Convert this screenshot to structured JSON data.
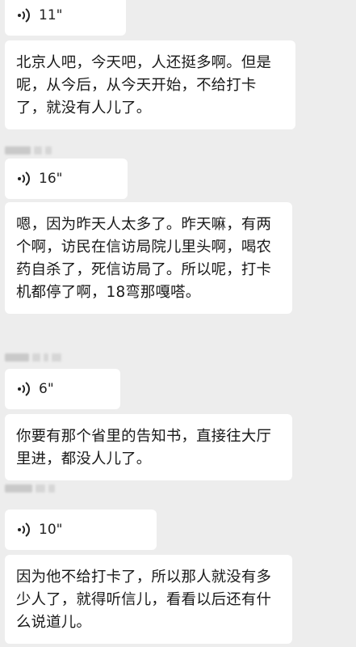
{
  "messages": [
    {
      "type": "voice",
      "duration": "11\""
    },
    {
      "type": "text",
      "text": "北京人吧，今天吧，人还挺多啊。但是呢，从今后，从今天开始，不给打卡了，就没有人儿了。"
    },
    {
      "type": "voice",
      "duration": "16\""
    },
    {
      "type": "text",
      "text": "嗯，因为昨天人太多了。昨天嘛，有两个啊，访民在信访局院儿里头啊，喝农药自杀了，死信访局了。所以呢，打卡机都停了啊，18弯那嘎嗒。"
    },
    {
      "type": "voice",
      "duration": "6\""
    },
    {
      "type": "text",
      "text": "你要有那个省里的告知书，直接往大厅里进，都没人儿了。"
    },
    {
      "type": "voice",
      "duration": "10\""
    },
    {
      "type": "text",
      "text": "因为他不给打卡了，所以那人就没有多少人了，就得听信儿，看看以后还有什么说道儿。"
    }
  ],
  "colors": {
    "background": "#ededed",
    "bubble": "#ffffff",
    "text": "#191919",
    "blurred_name": "#c9c9c9"
  },
  "icons": {
    "voice": "voice-wave-icon"
  }
}
